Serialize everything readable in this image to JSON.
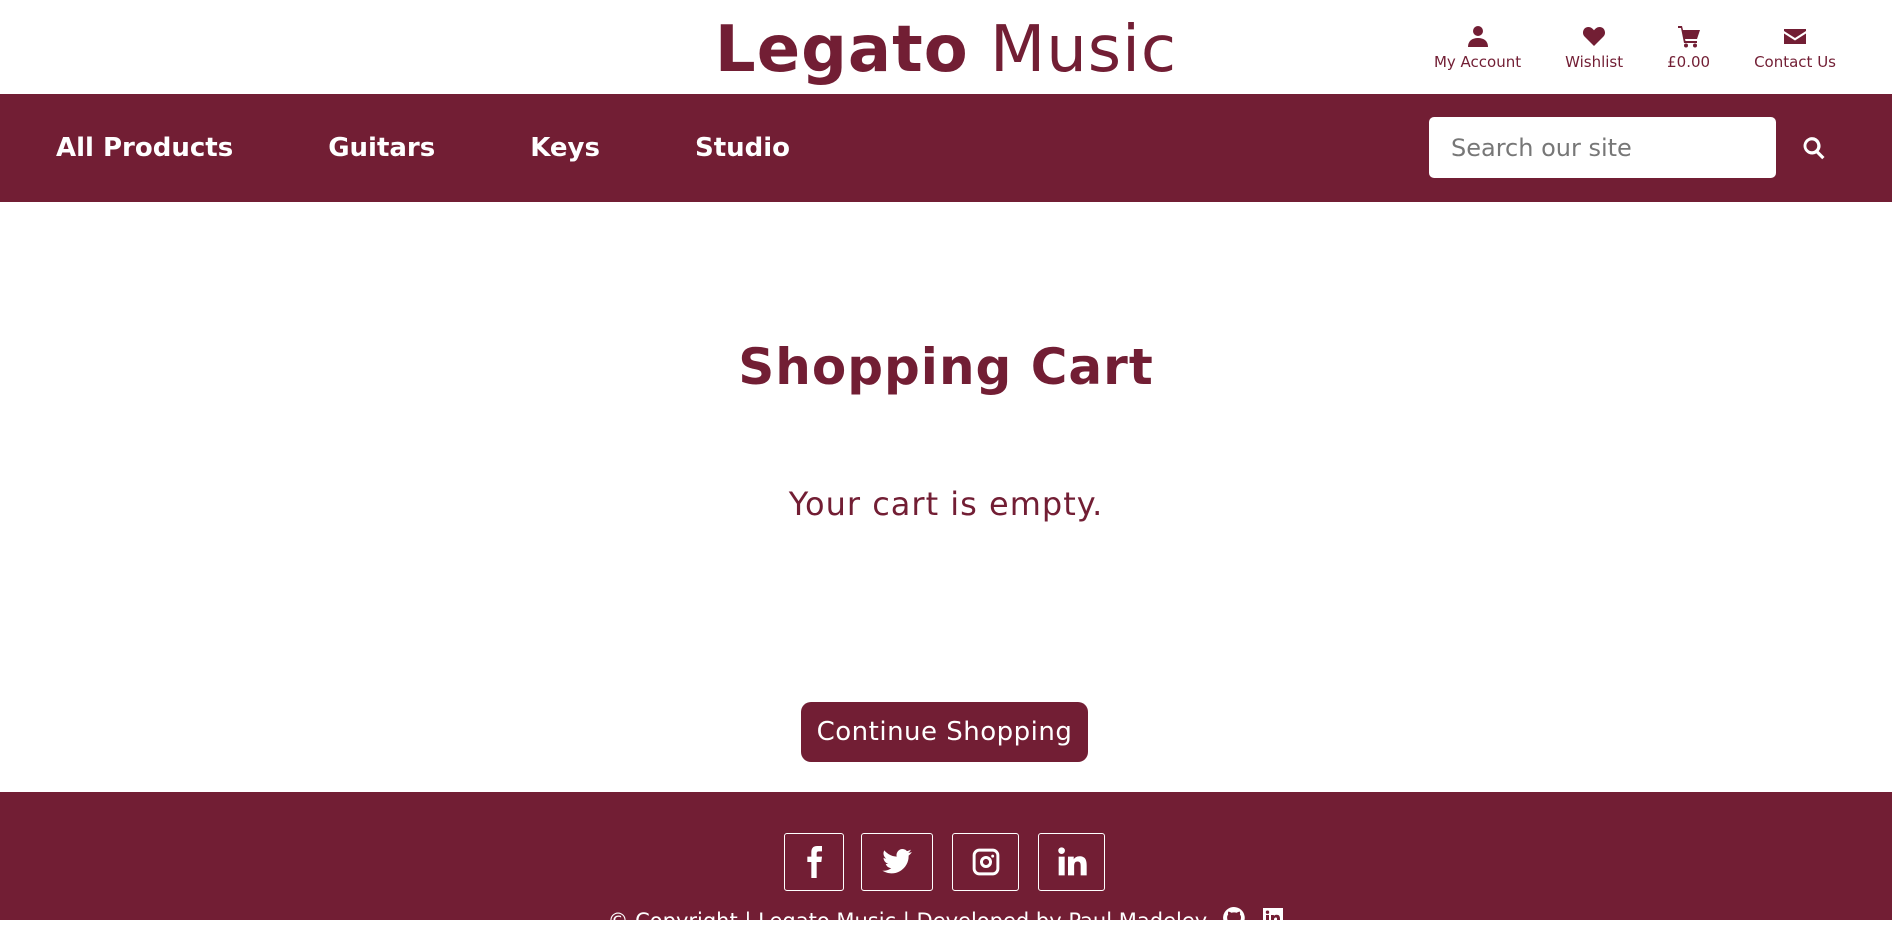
{
  "header": {
    "logo_bold": "Legato",
    "logo_light": "Music",
    "links": [
      {
        "label": "My Account",
        "icon": "user-icon"
      },
      {
        "label": "Wishlist",
        "icon": "heart-icon"
      },
      {
        "label": "£0.00",
        "icon": "cart-icon"
      },
      {
        "label": "Contact Us",
        "icon": "envelope-icon"
      }
    ]
  },
  "nav": {
    "items": [
      "All Products",
      "Guitars",
      "Keys",
      "Studio"
    ],
    "search_placeholder": "Search our site"
  },
  "main": {
    "title": "Shopping Cart",
    "empty_message": "Your cart is empty.",
    "continue_label": "Continue Shopping"
  },
  "footer": {
    "social": [
      "facebook-icon",
      "twitter-icon",
      "instagram-icon",
      "linkedin-icon"
    ],
    "copyright": "© Copyright | Legato Music | Developed by Paul Madeley"
  },
  "colors": {
    "brand": "#721e34",
    "background": "#ffffff"
  }
}
